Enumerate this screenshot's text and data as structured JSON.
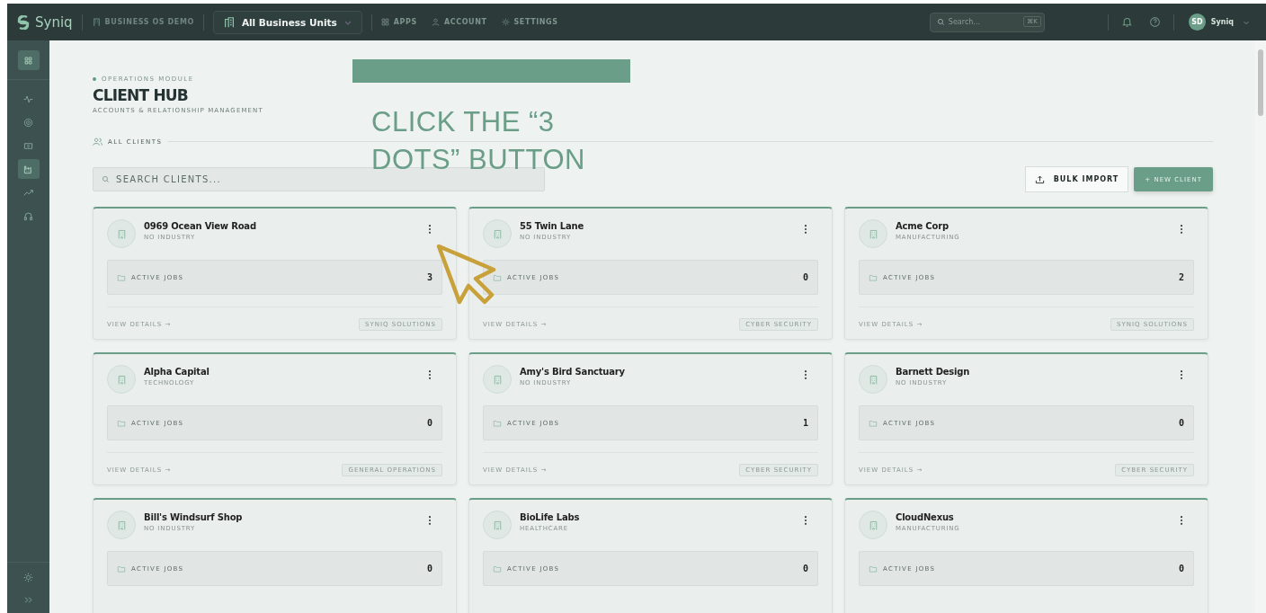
{
  "topbar": {
    "logo": "Syniq",
    "workspace": "BUSINESS OS DEMO",
    "unit_selector": "All Business Units",
    "nav": [
      {
        "label": "APPS"
      },
      {
        "label": "ACCOUNT"
      },
      {
        "label": "SETTINGS"
      }
    ],
    "search": {
      "placeholder": "Search...",
      "shortcut": "⌘K"
    },
    "avatar": "SD",
    "user": "Syniq"
  },
  "sidebar": {
    "items": [
      {
        "selected": true
      },
      {
        "selected": false
      },
      {
        "selected": false
      },
      {
        "selected": false
      },
      {
        "selected": true
      },
      {
        "selected": false
      },
      {
        "selected": false
      }
    ]
  },
  "header": {
    "module": "OPERATIONS MODULE",
    "title": "CLIENT HUB",
    "subtitle": "ACCOUNTS & RELATIONSHIP MANAGEMENT",
    "section": "ALL CLIENTS"
  },
  "search": {
    "placeholder": "SEARCH CLIENTS..."
  },
  "buttons": {
    "import": "BULK IMPORT",
    "new": "+ NEW CLIENT"
  },
  "overlay": {
    "instruction": "CLICK THE “3 DOTS” BUTTON"
  },
  "cards": [
    {
      "name": "0969 Ocean View Road",
      "industry": "NO INDUSTRY",
      "jobs_label": "ACTIVE JOBS",
      "jobs": "3",
      "link": "VIEW DETAILS →",
      "tag": "SYNIQ SOLUTIONS"
    },
    {
      "name": "55 Twin Lane",
      "industry": "NO INDUSTRY",
      "jobs_label": "ACTIVE JOBS",
      "jobs": "0",
      "link": "VIEW DETAILS →",
      "tag": "CYBER SECURITY"
    },
    {
      "name": "Acme Corp",
      "industry": "MANUFACTURING",
      "jobs_label": "ACTIVE JOBS",
      "jobs": "2",
      "link": "VIEW DETAILS →",
      "tag": "SYNIQ SOLUTIONS"
    },
    {
      "name": "Alpha Capital",
      "industry": "TECHNOLOGY",
      "jobs_label": "ACTIVE JOBS",
      "jobs": "0",
      "link": "VIEW DETAILS →",
      "tag": "GENERAL OPERATIONS"
    },
    {
      "name": "Amy's Bird Sanctuary",
      "industry": "NO INDUSTRY",
      "jobs_label": "ACTIVE JOBS",
      "jobs": "1",
      "link": "VIEW DETAILS →",
      "tag": "CYBER SECURITY"
    },
    {
      "name": "Barnett Design",
      "industry": "NO INDUSTRY",
      "jobs_label": "ACTIVE JOBS",
      "jobs": "0",
      "link": "VIEW DETAILS →",
      "tag": "CYBER SECURITY"
    },
    {
      "name": "Bill's Windsurf Shop",
      "industry": "NO INDUSTRY",
      "jobs_label": "ACTIVE JOBS",
      "jobs": "0"
    },
    {
      "name": "BioLife Labs",
      "industry": "HEALTHCARE",
      "jobs_label": "ACTIVE JOBS",
      "jobs": "0"
    },
    {
      "name": "CloudNexus",
      "industry": "MANUFACTURING",
      "jobs_label": "ACTIVE JOBS",
      "jobs": "0"
    }
  ]
}
